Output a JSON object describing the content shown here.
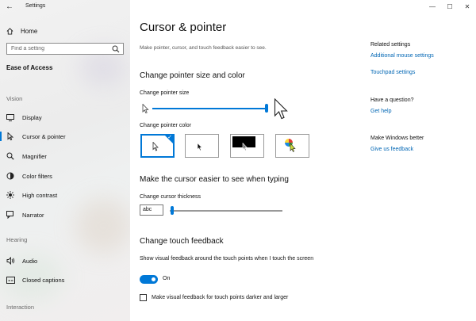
{
  "window": {
    "app_title": "Settings",
    "controls": {
      "minimize": "—",
      "maximize": "☐",
      "close": "✕"
    }
  },
  "sidebar": {
    "home_label": "Home",
    "search_placeholder": "Find a setting",
    "section_title": "Ease of Access",
    "groups": [
      {
        "label": "Vision",
        "items": [
          {
            "label": "Display",
            "icon": "monitor-icon"
          },
          {
            "label": "Cursor & pointer",
            "icon": "cursor-icon",
            "selected": true
          },
          {
            "label": "Magnifier",
            "icon": "magnifier-icon"
          },
          {
            "label": "Color filters",
            "icon": "color-filters-icon"
          },
          {
            "label": "High contrast",
            "icon": "high-contrast-icon"
          },
          {
            "label": "Narrator",
            "icon": "narrator-icon"
          }
        ]
      },
      {
        "label": "Hearing",
        "items": [
          {
            "label": "Audio",
            "icon": "audio-icon"
          },
          {
            "label": "Closed captions",
            "icon": "closed-captions-icon"
          }
        ]
      },
      {
        "label": "Interaction",
        "items": []
      }
    ]
  },
  "main": {
    "title": "Cursor & pointer",
    "description": "Make pointer, cursor, and touch feedback easier to see.",
    "pointer_section": {
      "title": "Change pointer size and color",
      "size_label": "Change pointer size",
      "size_level": 0.99,
      "color_label": "Change pointer color",
      "color_options": [
        {
          "name": "white-pointer-option",
          "selected": true
        },
        {
          "name": "black-pointer-option",
          "selected": false
        },
        {
          "name": "inverted-pointer-option",
          "selected": false
        },
        {
          "name": "custom-pointer-option",
          "selected": false
        }
      ]
    },
    "cursor_section": {
      "title": "Make the cursor easier to see when typing",
      "thickness_label": "Change cursor thickness",
      "preview_text": "abc",
      "thickness_level": 0.02
    },
    "touch_section": {
      "title": "Change touch feedback",
      "show_feedback_label": "Show visual feedback around the touch points when I touch the screen",
      "toggle_state": "On",
      "darker_label": "Make visual feedback for touch points darker and larger",
      "darker_checked": false
    },
    "related": {
      "header": "Related settings",
      "links": [
        "Additional mouse settings",
        "Touchpad settings"
      ],
      "question_header": "Have a question?",
      "help_link": "Get help",
      "better_header": "Make Windows better",
      "feedback_link": "Give us feedback"
    }
  },
  "colors": {
    "accent": "#0078d7",
    "link": "#0066b4"
  }
}
